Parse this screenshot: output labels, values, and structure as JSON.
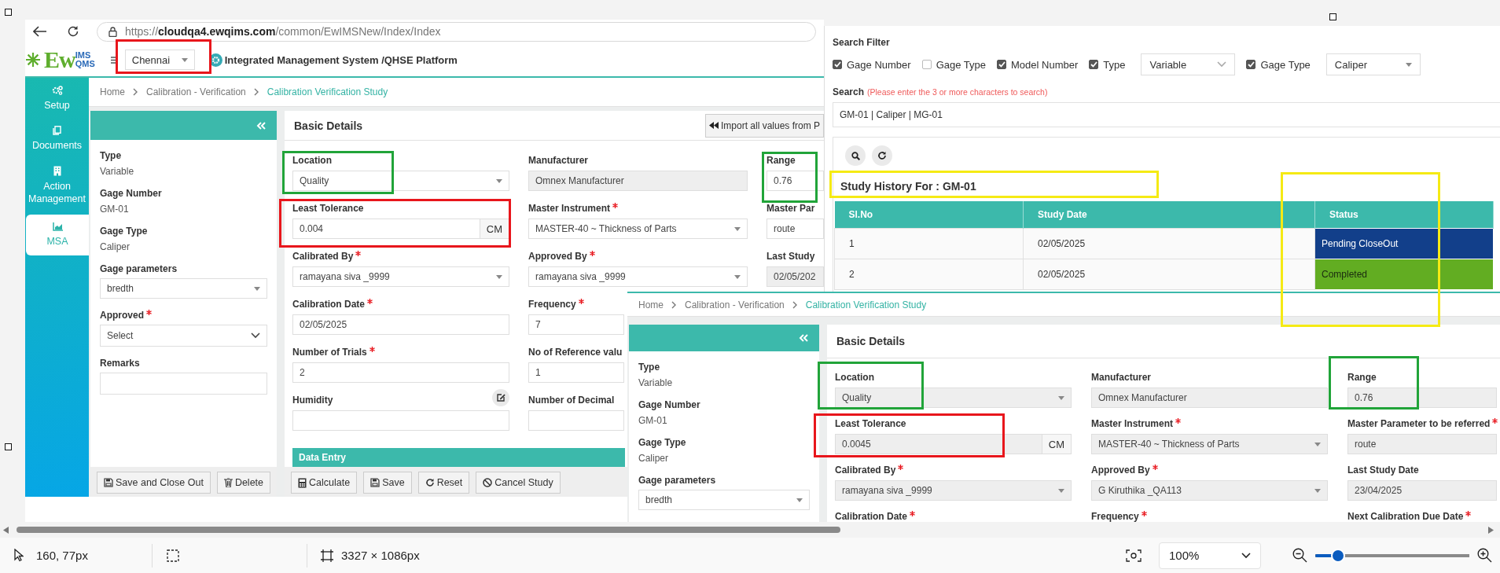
{
  "canvas": {
    "main_screen": {
      "browser": {
        "url": "https://**cloudqa4.ewqims.com**/common/EwIMSNew/Index/Index"
      },
      "header": {
        "logo": [
          "Ew",
          "IMS",
          "QMS"
        ],
        "location": "Chennai",
        "title": "Integrated Management System /QHSE Platform"
      },
      "nav": [
        {
          "label": "Setup",
          "selected": false
        },
        {
          "label": "Documents",
          "selected": false
        },
        {
          "label": "Action Management",
          "selected": false
        },
        {
          "label": "MSA",
          "selected": true
        }
      ],
      "study": {
        "breadcrumb": [
          "Home",
          "Calibration - Verification",
          "Calibration Verification Study"
        ],
        "side_fields": [
          {
            "label": "Type",
            "required": false,
            "kind": "text",
            "value": "Variable"
          },
          {
            "label": "Gage Number",
            "required": false,
            "kind": "text",
            "value": "GM-01"
          },
          {
            "label": "Gage Type",
            "required": false,
            "kind": "text",
            "value": "Caliper"
          },
          {
            "label": "Gage parameters",
            "required": false,
            "kind": "select",
            "value": "bredth"
          },
          {
            "label": "Approved",
            "required": true,
            "kind": "dropdown",
            "value": "Select"
          },
          {
            "label": "Remarks",
            "required": false,
            "kind": "input"
          }
        ],
        "side_buttons": [
          {
            "kind": "save_close",
            "label": "Save and Close Out"
          },
          {
            "kind": "delete",
            "label": "Delete"
          }
        ],
        "title": "Basic Details",
        "import_button": "Import all values from P",
        "disabled": false,
        "rows": [
          [
            {
              "label": "Location",
              "required": false,
              "kind": "select",
              "value": "Quality"
            },
            {
              "label": "Manufacturer",
              "required": false,
              "kind": "readonly",
              "value": "Omnex Manufacturer"
            },
            {
              "label": "Range",
              "required": false,
              "kind": "input",
              "value": "0.76"
            }
          ],
          [
            {
              "label": "Least Tolerance",
              "required": false,
              "kind": "unit",
              "value": "0.004",
              "unit": "CM"
            },
            {
              "label": "Master Instrument",
              "required": true,
              "kind": "select",
              "value": "MASTER-40 ~ Thickness of Parts"
            },
            {
              "label": "Master Par",
              "required": false,
              "kind": "input",
              "value": "route"
            }
          ],
          [
            {
              "label": "Calibrated By",
              "required": true,
              "kind": "select",
              "value": "ramayana siva _9999"
            },
            {
              "label": "Approved By",
              "required": true,
              "kind": "select",
              "value": "ramayana siva _9999"
            },
            {
              "label": "Last Study",
              "required": false,
              "kind": "readonly",
              "value": "02/05/202"
            }
          ],
          [
            {
              "label": "Calibration Date",
              "required": true,
              "kind": "input",
              "value": "02/05/2025"
            },
            {
              "label": "Frequency",
              "required": true,
              "kind": "input",
              "value": "7"
            }
          ],
          [
            {
              "label": "Number of Trials",
              "required": true,
              "kind": "input",
              "value": "2"
            },
            {
              "label": "No of Reference valu",
              "required": false,
              "kind": "input",
              "value": "1"
            }
          ],
          [
            {
              "label": "Humidity",
              "required": false,
              "kind": "note"
            },
            {
              "label": "Number of Decimal",
              "required": false,
              "kind": "input"
            }
          ]
        ],
        "section": "Data Entry",
        "buttons": [
          {
            "kind": "calculate",
            "label": "Calculate"
          },
          {
            "kind": "save",
            "label": "Save"
          },
          {
            "kind": "reset",
            "label": "Reset"
          },
          {
            "kind": "cancel",
            "label": "Cancel Study"
          }
        ]
      }
    },
    "search_screen": {
      "title": "Search Filter",
      "filters": [
        {
          "label": "Gage Number",
          "checked": true
        },
        {
          "label": "Gage Type",
          "checked": false
        },
        {
          "label": "Model Number",
          "checked": true
        },
        {
          "label": "Type",
          "checked": true,
          "select": "Variable"
        },
        {
          "label": "Gage Type",
          "checked": true,
          "select": "Caliper"
        }
      ],
      "search_label": "Search",
      "search_hint": "(Please enter the 3 or more characters to search)",
      "search_value": "GM-01 | Caliper | MG-01",
      "history_title": "Study History For : GM-01",
      "columns": [
        "Sl.No",
        "Study Date",
        "Status"
      ],
      "rows": [
        {
          "number": "1",
          "date": "02/05/2025",
          "status": "Pending CloseOut",
          "color": "#123f8a"
        },
        {
          "number": "2",
          "date": "02/05/2025",
          "status": "Completed",
          "color": "#62ad22"
        }
      ]
    },
    "study_screen": {
      "breadcrumb": [
        "Home",
        "Calibration - Verification",
        "Calibration Verification Study"
      ],
      "side_fields": [
        {
          "label": "Type",
          "required": false,
          "kind": "text",
          "value": "Variable"
        },
        {
          "label": "Gage Number",
          "required": false,
          "kind": "text",
          "value": "GM-01"
        },
        {
          "label": "Gage Type",
          "required": false,
          "kind": "text",
          "value": "Caliper"
        },
        {
          "label": "Gage parameters",
          "required": false,
          "kind": "select",
          "value": "bredth"
        }
      ],
      "title": "Basic Details",
      "disabled": true,
      "rows": [
        [
          {
            "label": "Location",
            "required": false,
            "kind": "select",
            "value": "Quality"
          },
          {
            "label": "Manufacturer",
            "required": false,
            "kind": "readonly",
            "value": "Omnex Manufacturer"
          },
          {
            "label": "Range",
            "required": false,
            "kind": "input",
            "value": "0.76"
          }
        ],
        [
          {
            "label": "Least Tolerance",
            "required": false,
            "kind": "unit",
            "value": "0.0045",
            "unit": "CM"
          },
          {
            "label": "Master Instrument",
            "required": true,
            "kind": "select",
            "value": "MASTER-40 ~ Thickness of Parts"
          },
          {
            "label": "Master Parameter to be referred",
            "required": true,
            "kind": "input",
            "value": "route"
          }
        ],
        [
          {
            "label": "Calibrated By",
            "required": true,
            "kind": "select",
            "value": "ramayana siva _9999"
          },
          {
            "label": "Approved By",
            "required": true,
            "kind": "select",
            "value": "G Kiruthika _QA113"
          },
          {
            "label": "Last Study Date",
            "required": false,
            "kind": "input",
            "value": "23/04/2025"
          }
        ],
        [
          {
            "label": "Calibration Date",
            "required": true,
            "kind": "label"
          },
          {
            "label": "Frequency",
            "required": true,
            "kind": "label"
          },
          {
            "label": "Next Calibration Due Date",
            "required": true,
            "kind": "label"
          }
        ]
      ]
    },
    "annotations": [
      {
        "color": "#e8161c"
      },
      {
        "color": "#21a439"
      },
      {
        "color": "#e8161c"
      },
      {
        "color": "#21a439"
      },
      {
        "color": "#f5ea14"
      },
      {
        "color": "#f5ea14"
      },
      {
        "color": "#21a439"
      },
      {
        "color": "#21a439"
      },
      {
        "color": "#e8161c"
      }
    ]
  },
  "status_bar": {
    "pointer": "160, 77px",
    "image_size": "3327 × 1086px",
    "zoom": "100%",
    "zoom_slider": {
      "level": 0.15
    }
  }
}
